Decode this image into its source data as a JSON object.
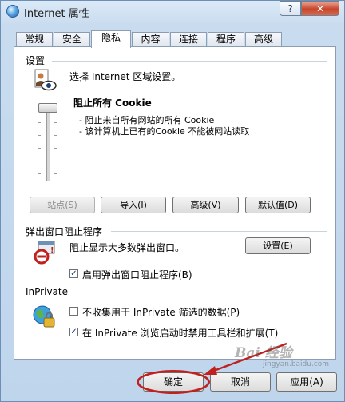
{
  "window": {
    "title": "Internet 属性",
    "help_label": "?",
    "close_label": "✕"
  },
  "tabs": [
    {
      "label": "常规"
    },
    {
      "label": "安全"
    },
    {
      "label": "隐私",
      "active": true
    },
    {
      "label": "内容"
    },
    {
      "label": "连接"
    },
    {
      "label": "程序"
    },
    {
      "label": "高级"
    }
  ],
  "settings": {
    "label": "设置",
    "instruction": "选择 Internet 区域设置。",
    "level_title": "阻止所有 Cookie",
    "desc_lines": [
      "- 阻止来自所有网站的所有 Cookie",
      "- 该计算机上已有的Cookie 不能被网站读取"
    ],
    "slider_level": "highest",
    "buttons": {
      "sites": "站点(S)",
      "import": "导入(I)",
      "advanced": "高级(V)",
      "default": "默认值(D)"
    }
  },
  "popup_blocker": {
    "label": "弹出窗口阻止程序",
    "description": "阻止显示大多数弹出窗口。",
    "settings_button": "设置(E)",
    "enable_label": "启用弹出窗口阻止程序(B)",
    "enable_checked": true
  },
  "inprivate": {
    "label": "InPrivate",
    "no_collect_label": "不收集用于 InPrivate 筛选的数据(P)",
    "no_collect_checked": false,
    "disable_toolbars_label": "在 InPrivate 浏览启动时禁用工具栏和扩展(T)",
    "disable_toolbars_checked": true
  },
  "footer": {
    "ok": "确定",
    "cancel": "取消",
    "apply": "应用(A)"
  },
  "watermark": {
    "text": "Bai 经验",
    "sub": "jingyan.baidu.com"
  },
  "colors": {
    "annotation": "#c0211f",
    "title_bar": "#c9dcef",
    "close_button": "#c7452b"
  }
}
